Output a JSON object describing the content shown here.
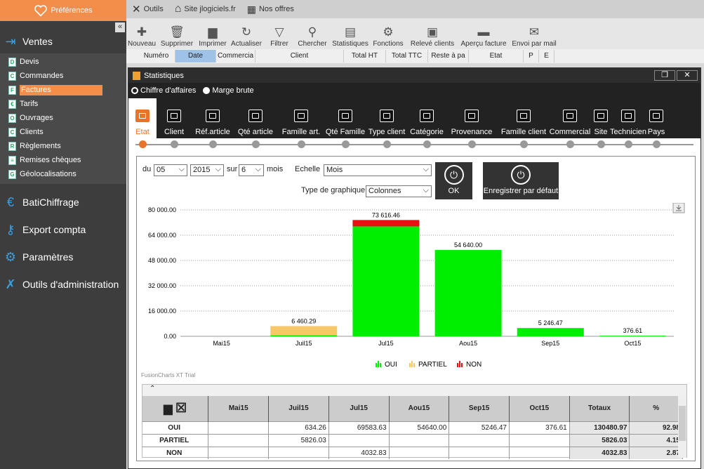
{
  "sidebar": {
    "preferences": "Préférences",
    "ventes": "Ventes",
    "items": [
      {
        "label": "Devis",
        "letter": "D"
      },
      {
        "label": "Commandes",
        "letter": "C"
      },
      {
        "label": "Factures",
        "letter": "F"
      },
      {
        "label": "Tarifs",
        "letter": "€"
      },
      {
        "label": "Ouvrages",
        "letter": "O"
      },
      {
        "label": "Clients",
        "letter": "C"
      },
      {
        "label": "Règlements",
        "letter": "R"
      },
      {
        "label": "Remises chèques",
        "letter": "≡"
      },
      {
        "label": "Géolocalisations",
        "letter": "G"
      }
    ],
    "sections": [
      "BatiChiffrage",
      "Export compta",
      "Paramètres",
      "Outils d'administration"
    ]
  },
  "topbar": {
    "tools": "Outils",
    "site": "Site jlogiciels.fr",
    "offers": "Nos offres"
  },
  "toolbar": [
    "Nouveau",
    "Supprimer",
    "Imprimer",
    "Actualiser",
    "Filtrer",
    "Chercher",
    "Statistiques",
    "Fonctions",
    "Relevé clients",
    "Aperçu facture",
    "Envoi par mail"
  ],
  "columns": [
    "Numéro",
    "Date",
    "Commercia",
    "Client",
    "Total HT",
    "Total TTC",
    "Reste à pa",
    "Etat",
    "P",
    "E"
  ],
  "dialog": {
    "title": "Statistiques",
    "radio1": "Chiffre d'affaires",
    "radio2": "Marge brute",
    "tabs": [
      "Etat",
      "Client",
      "Réf.article",
      "Qté article",
      "Famille art.",
      "Qté Famille",
      "Type client",
      "Catégorie",
      "Provenance",
      "Famille client",
      "Commercial",
      "Site",
      "Technicien",
      "Pays"
    ],
    "du": "du",
    "month": "05",
    "year": "2015",
    "sur": "sur",
    "count": "6",
    "mois": "mois",
    "echelle_label": "Echelle",
    "echelle": "Mois",
    "type_label": "Type de graphique",
    "type": "Colonnes",
    "ok": "OK",
    "save_default": "Enregistrer par défaut",
    "fusion": "FusionCharts XT Trial"
  },
  "chart_data": {
    "type": "bar",
    "stacked": true,
    "categories": [
      "Mai15",
      "Juil15",
      "Jul15",
      "Aou15",
      "Sep15",
      "Oct15"
    ],
    "series": [
      {
        "name": "OUI",
        "color": "#00ee00",
        "values": [
          0,
          634.26,
          69583.63,
          54640.0,
          5246.47,
          376.61
        ]
      },
      {
        "name": "PARTIEL",
        "color": "#f7c86a",
        "values": [
          0,
          5826.03,
          0,
          0,
          0,
          0
        ]
      },
      {
        "name": "NON",
        "color": "#e81010",
        "values": [
          0,
          0,
          4032.83,
          0,
          0,
          0
        ]
      }
    ],
    "totals": [
      "",
      "6 460.29",
      "73 616.46",
      "54 640.00",
      "5 246.47",
      "376.61"
    ],
    "ylim": [
      0,
      80000
    ],
    "yticks": [
      "0.00",
      "16 000.00",
      "32 000.00",
      "48 000.00",
      "64 000.00",
      "80 000.00"
    ],
    "legend_position": "bottom"
  },
  "table": {
    "headers": [
      "Mai15",
      "Juil15",
      "Jul15",
      "Aou15",
      "Sep15",
      "Oct15",
      "Totaux",
      "%"
    ],
    "rows": [
      {
        "label": "OUI",
        "cells": [
          "",
          "634.26",
          "69583.63",
          "54640.00",
          "5246.47",
          "376.61",
          "130480.97",
          "92.98"
        ]
      },
      {
        "label": "PARTIEL",
        "cells": [
          "",
          "5826.03",
          "",
          "",
          "",
          "",
          "5826.03",
          "4.15"
        ]
      },
      {
        "label": "NON",
        "cells": [
          "",
          "",
          "4032.83",
          "",
          "",
          "",
          "4032.83",
          "2.87"
        ]
      }
    ]
  }
}
